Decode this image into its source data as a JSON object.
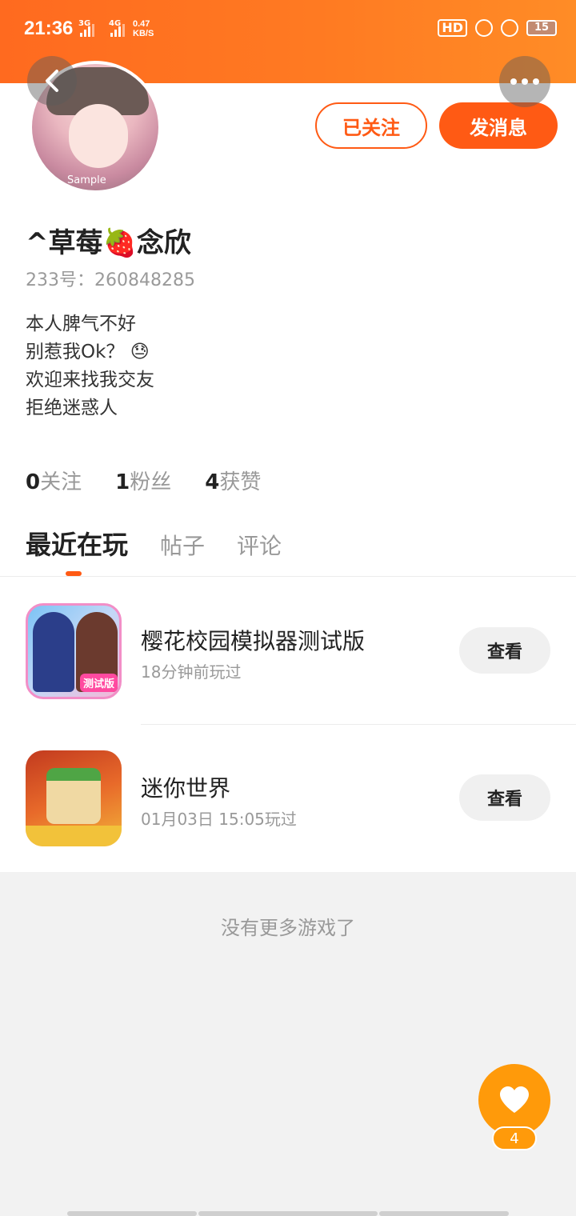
{
  "status_bar": {
    "time": "21:36",
    "net1": "3G",
    "net2": "4G",
    "speed_value": "0.47",
    "speed_unit": "KB/S",
    "hd": "HD",
    "battery": "15"
  },
  "profile": {
    "avatar_tag": "Sample",
    "follow_label": "已关注",
    "message_label": "发消息",
    "username": "^草莓🍓念欣",
    "user_id": "233号：260848285",
    "bio": [
      "本人脾气不好",
      "别惹我Ok？ 😓",
      "欢迎来找我交友",
      "拒绝迷惑人"
    ]
  },
  "stats": [
    {
      "count": "0",
      "label": "关注"
    },
    {
      "count": "1",
      "label": "粉丝"
    },
    {
      "count": "4",
      "label": "获赞"
    }
  ],
  "tabs": [
    {
      "label": "最近在玩",
      "active": true
    },
    {
      "label": "帖子",
      "active": false
    },
    {
      "label": "评论",
      "active": false
    }
  ],
  "games": [
    {
      "title": "樱花校园模拟器测试版",
      "subtitle": "18分钟前玩过",
      "button": "查看",
      "icon_badge": "测试版"
    },
    {
      "title": "迷你世界",
      "subtitle": "01月03日 15:05玩过",
      "button": "查看"
    }
  ],
  "no_more_text": "没有更多游戏了",
  "like": {
    "count": "4"
  },
  "colors": {
    "accent": "#ff5a14",
    "header": "#ff7a22",
    "like": "#ff9a0a"
  }
}
